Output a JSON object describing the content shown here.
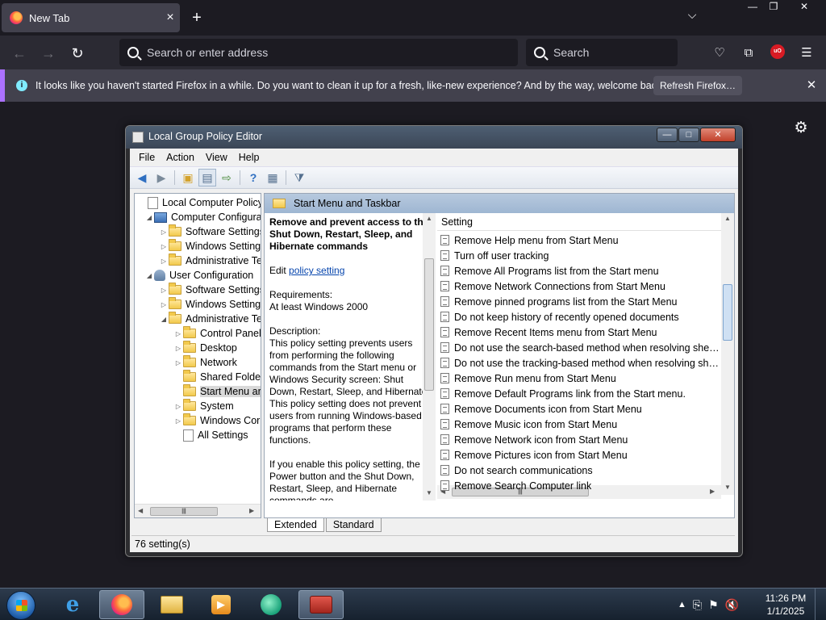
{
  "browser": {
    "tab_title": "New Tab",
    "address_placeholder": "Search or enter address",
    "search_placeholder": "Search",
    "notification": "It looks like you haven't started Firefox in a while. Do you want to clean it up for a fresh, like-new experience? And by the way, welcome back!",
    "refresh_label": "Refresh Firefox…",
    "ublock_badge": "uO"
  },
  "gpe": {
    "title": "Local Group Policy Editor",
    "menu": [
      "File",
      "Action",
      "View",
      "Help"
    ],
    "tree": [
      {
        "label": "Local Computer Policy",
        "icon": "doc",
        "arrow": ""
      },
      {
        "label": "Computer Configura",
        "icon": "pc",
        "arrow": "◢"
      },
      {
        "label": "Software Settings",
        "icon": "folder",
        "arrow": "▷"
      },
      {
        "label": "Windows Setting",
        "icon": "folder",
        "arrow": "▷"
      },
      {
        "label": "Administrative Te",
        "icon": "folder",
        "arrow": "▷"
      },
      {
        "label": "User Configuration",
        "icon": "user",
        "arrow": "◢"
      },
      {
        "label": "Software Settings",
        "icon": "folder",
        "arrow": "▷"
      },
      {
        "label": "Windows Setting",
        "icon": "folder",
        "arrow": "▷"
      },
      {
        "label": "Administrative Te",
        "icon": "folder",
        "arrow": "◢"
      },
      {
        "label": "Control Panel",
        "icon": "folder",
        "arrow": "▷"
      },
      {
        "label": "Desktop",
        "icon": "folder",
        "arrow": "▷"
      },
      {
        "label": "Network",
        "icon": "folder",
        "arrow": "▷"
      },
      {
        "label": "Shared Folder",
        "icon": "folder",
        "arrow": ""
      },
      {
        "label": "Start Menu ar",
        "icon": "folder",
        "arrow": ""
      },
      {
        "label": "System",
        "icon": "folder",
        "arrow": "▷"
      },
      {
        "label": "Windows Cor",
        "icon": "folder",
        "arrow": "▷"
      },
      {
        "label": "All Settings",
        "icon": "doc",
        "arrow": ""
      }
    ],
    "pane_title": "Start Menu and Taskbar",
    "desc": {
      "title": "Remove and prevent access to the Shut Down, Restart, Sleep, and Hibernate commands",
      "edit_prefix": "Edit ",
      "edit_link": "policy setting ",
      "req_label": "Requirements:",
      "req_value": "At least Windows 2000",
      "desc_label": "Description:",
      "desc_text": "This policy setting prevents users from performing the following commands from the Start menu or Windows Security screen: Shut Down, Restart, Sleep, and Hibernate. This policy setting does not prevent users from running Windows-based programs that perform these functions.",
      "desc_text2": "If you enable this policy setting, the Power button and the Shut Down, Restart, Sleep, and Hibernate commands are"
    },
    "column_header": "Setting",
    "settings": [
      "Remove Help menu from Start Menu",
      "Turn off user tracking",
      "Remove All Programs list from the Start menu",
      "Remove Network Connections from Start Menu",
      "Remove pinned programs list from the Start Menu",
      "Do not keep history of recently opened documents",
      "Remove Recent Items menu from Start Menu",
      "Do not use the search-based method when resolving shell s...",
      "Do not use the tracking-based method when resolving shell ...",
      "Remove Run menu from Start Menu",
      "Remove Default Programs link from the Start menu.",
      "Remove Documents icon from Start Menu",
      "Remove Music icon from Start Menu",
      "Remove Network icon from Start Menu",
      "Remove Pictures icon from Start Menu",
      "Do not search communications",
      "Remove Search Computer link"
    ],
    "view_tabs": [
      "Extended",
      "Standard"
    ],
    "status": "76 setting(s)"
  },
  "taskbar": {
    "time": "11:26 PM",
    "date": "1/1/2025"
  }
}
